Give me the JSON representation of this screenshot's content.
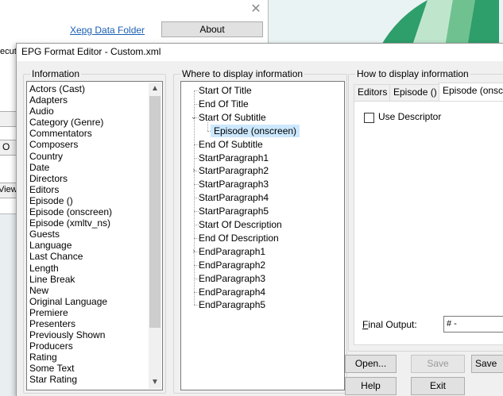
{
  "background_window": {
    "link_label": "Xepg Data Folder",
    "about_label": "About",
    "fragment_execute": "ecut",
    "fragment_o": "O",
    "fragment_view": "View"
  },
  "dialog": {
    "title": "EPG Format Editor - Custom.xml",
    "information": {
      "label": "Information",
      "items": [
        "Actors (Cast)",
        "Adapters",
        "Audio",
        "Category (Genre)",
        "Commentators",
        "Composers",
        "Country",
        "Date",
        "Directors",
        "Editors",
        "Episode ()",
        "Episode (onscreen)",
        "Episode (xmltv_ns)",
        "Guests",
        "Language",
        "Last Chance",
        "Length",
        "Line Break",
        "New",
        "Original Language",
        "Premiere",
        "Presenters",
        "Previously Shown",
        "Producers",
        "Rating",
        "Some Text",
        "Star Rating"
      ]
    },
    "where": {
      "label": "Where to display information",
      "nodes": [
        {
          "label": "Start Of Title",
          "level": 0,
          "expander": ""
        },
        {
          "label": "End Of Title",
          "level": 0,
          "expander": ""
        },
        {
          "label": "Start Of Subtitle",
          "level": 0,
          "expander": "expanded"
        },
        {
          "label": "Episode (onscreen)",
          "level": 1,
          "expander": "",
          "selected": true
        },
        {
          "label": "End Of Subtitle",
          "level": 0,
          "expander": ""
        },
        {
          "label": "StartParagraph1",
          "level": 0,
          "expander": ""
        },
        {
          "label": "StartParagraph2",
          "level": 0,
          "expander": "collapsed"
        },
        {
          "label": "StartParagraph3",
          "level": 0,
          "expander": ""
        },
        {
          "label": "StartParagraph4",
          "level": 0,
          "expander": ""
        },
        {
          "label": "StartParagraph5",
          "level": 0,
          "expander": ""
        },
        {
          "label": "Start Of Description",
          "level": 0,
          "expander": ""
        },
        {
          "label": "End Of Description",
          "level": 0,
          "expander": ""
        },
        {
          "label": "EndParagraph1",
          "level": 0,
          "expander": "collapsed"
        },
        {
          "label": "EndParagraph2",
          "level": 0,
          "expander": ""
        },
        {
          "label": "EndParagraph3",
          "level": 0,
          "expander": ""
        },
        {
          "label": "EndParagraph4",
          "level": 0,
          "expander": ""
        },
        {
          "label": "EndParagraph5",
          "level": 0,
          "expander": ""
        }
      ]
    },
    "how": {
      "label": "How to display information",
      "tabs": [
        "Editors",
        "Episode ()",
        "Episode (onscre"
      ],
      "active_tab": 2,
      "use_descriptor_label": "Use Descriptor",
      "use_descriptor_checked": false,
      "final_output_label_mnemonic": "F",
      "final_output_label_rest": "inal Output:",
      "final_output_value": "# -"
    },
    "buttons": {
      "open": "Open...",
      "save": "Save",
      "save_as": "Save",
      "help": "Help",
      "exit": "Exit"
    }
  },
  "colors": {
    "selection": "#cce8ff",
    "link": "#1a5fb4",
    "accent_green": "#2e9e6b"
  }
}
